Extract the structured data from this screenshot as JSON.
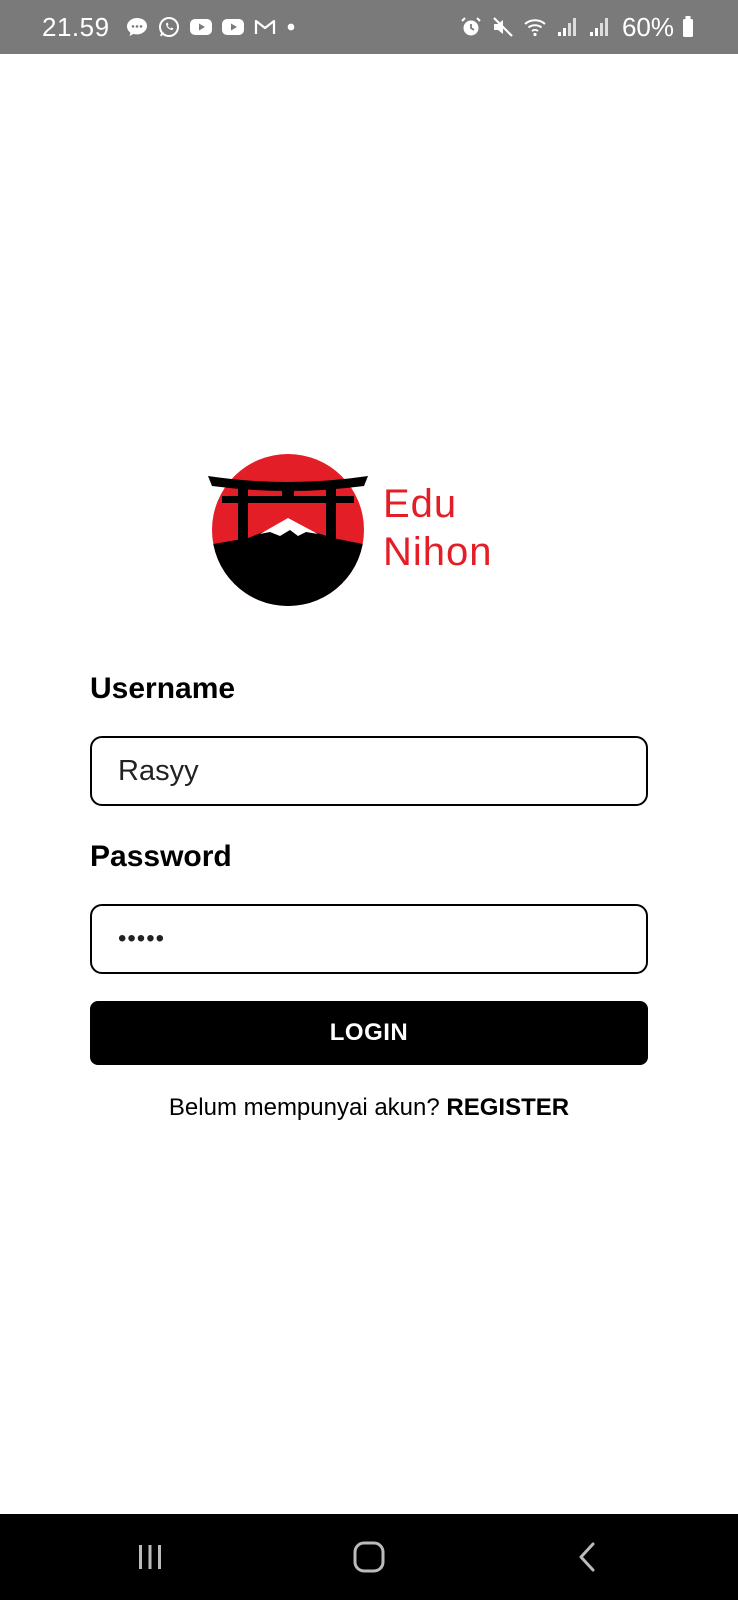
{
  "status_bar": {
    "time": "21.59",
    "battery_percent": "60%",
    "left_icons": [
      "message-icon",
      "whatsapp-icon",
      "youtube-icon",
      "youtube-icon",
      "gmail-icon",
      "dot-icon"
    ],
    "right_icons": [
      "alarm-icon",
      "mute-icon",
      "wifi-icon",
      "signal-icon",
      "signal-icon",
      "battery-icon"
    ]
  },
  "logo": {
    "line1": "Edu",
    "line2": "Nihon",
    "brand_color": "#e41e26"
  },
  "form": {
    "username_label": "Username",
    "username_value": "Rasyy",
    "password_label": "Password",
    "password_value": "•••••",
    "login_label": "LOGIN"
  },
  "register": {
    "prompt": "Belum mempunyai akun?",
    "link_label": "REGISTER"
  },
  "nav": {
    "icons": [
      "recent-apps-icon",
      "home-icon",
      "back-icon"
    ]
  }
}
